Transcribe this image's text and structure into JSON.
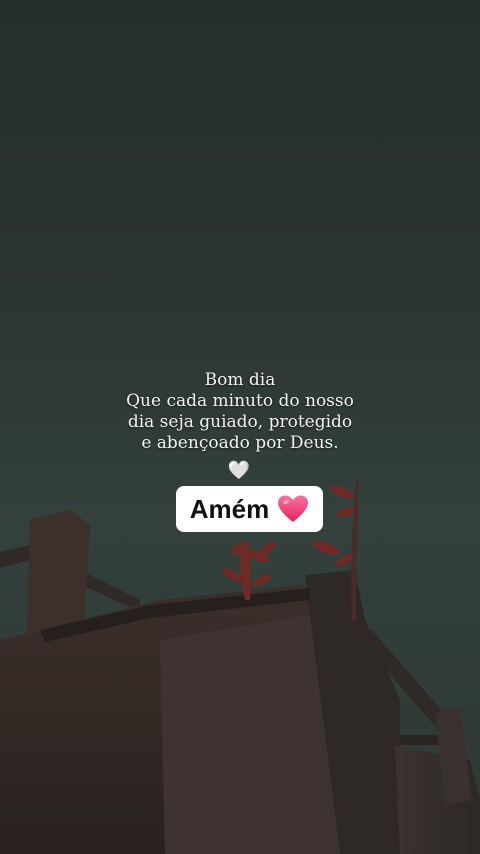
{
  "message": {
    "lines": [
      "Bom dia",
      "Que cada minuto do nosso",
      "dia seja guiado, protegido",
      "e abençoado por Deus."
    ],
    "white_heart": "🤍"
  },
  "sticker": {
    "label": "Amém",
    "heart_icon": "pink-heart-icon",
    "heart_color": "#e8336f"
  },
  "colors": {
    "sky": "#2b3532",
    "ruin": "#3a302b"
  }
}
